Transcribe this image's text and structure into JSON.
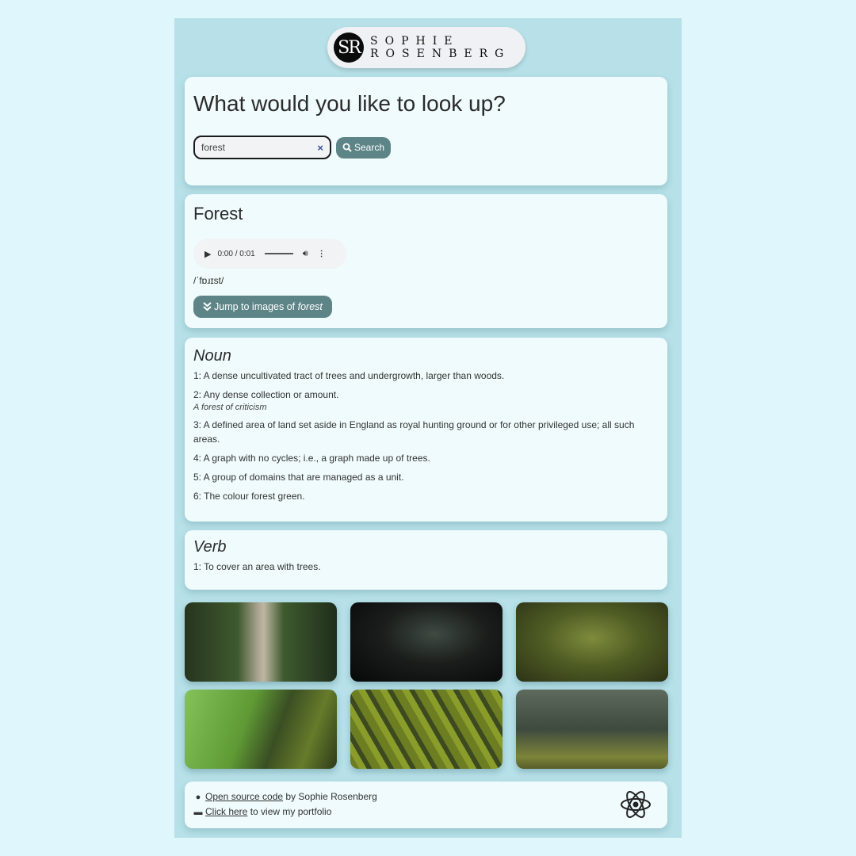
{
  "logo": {
    "monogram": "SR",
    "line1": "SOPHIE",
    "line2": "ROSENBERG"
  },
  "search": {
    "heading": "What would you like to look up?",
    "input_value": "forest",
    "clear_icon": "×",
    "button_label": "Search"
  },
  "word": {
    "title": "Forest",
    "audio": {
      "time": "0:00 / 0:01"
    },
    "phonetic": "/ˈfɒɹɪst/",
    "jump_label_prefix": "Jump to images of ",
    "jump_label_word": "forest"
  },
  "meanings": [
    {
      "part_of_speech": "Noun",
      "definitions": [
        {
          "text": "1: A dense uncultivated tract of trees and undergrowth, larger than woods."
        },
        {
          "text": "2: Any dense collection or amount.",
          "example": "A forest of criticism"
        },
        {
          "text": "3: A defined area of land set aside in England as royal hunting ground or for other privileged use; all such areas."
        },
        {
          "text": "4: A graph with no cycles; i.e., a graph made up of trees."
        },
        {
          "text": "5: A group of domains that are managed as a unit."
        },
        {
          "text": "6: The colour forest green."
        }
      ]
    },
    {
      "part_of_speech": "Verb",
      "definitions": [
        {
          "text": "1: To cover an area with trees."
        }
      ]
    }
  ],
  "gallery": [
    {
      "alt": "suspension bridge in forest"
    },
    {
      "alt": "dark misty forest"
    },
    {
      "alt": "large old tree in green forest"
    },
    {
      "alt": "mossy tree roots"
    },
    {
      "alt": "aerial view of pine forest"
    },
    {
      "alt": "sunlit forest with tall trunks"
    }
  ],
  "footer": {
    "line1_link": "Open source code",
    "line1_rest": " by Sophie Rosenberg",
    "line2_link": "Click here",
    "line2_rest": " to view my portfolio"
  },
  "colors": {
    "page_bg": "#dff6fc",
    "app_bg": "#b7e0e8",
    "card_bg": "#effbfc",
    "button_bg": "#5d8487"
  }
}
